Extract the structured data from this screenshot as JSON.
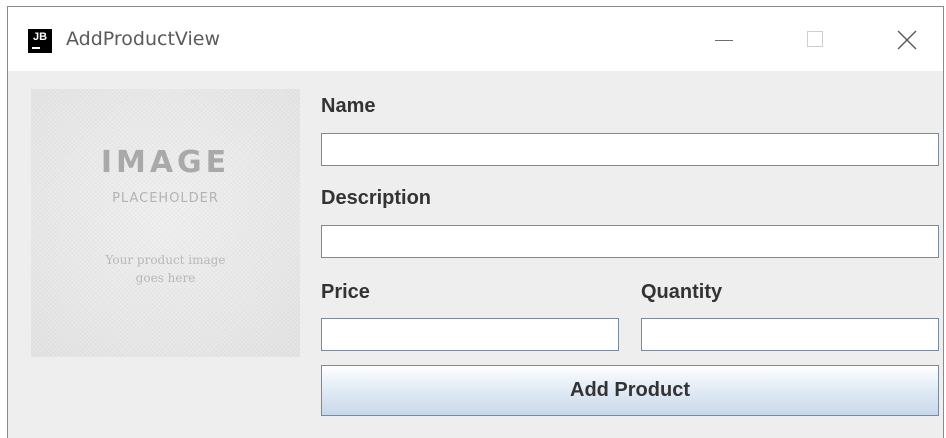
{
  "window": {
    "title": "AddProductView",
    "app_icon": "JB"
  },
  "titlebar_buttons": {
    "minimize": "minimize-icon",
    "maximize": "maximize-icon",
    "close": "close-icon"
  },
  "image_placeholder": {
    "title": "IMAGE",
    "subtitle": "PLACEHOLDER",
    "caption_line1": "Your product image",
    "caption_line2": "goes here"
  },
  "form": {
    "name_label": "Name",
    "name_value": "",
    "description_label": "Description",
    "description_value": "",
    "price_label": "Price",
    "price_value": "",
    "quantity_label": "Quantity",
    "quantity_value": ""
  },
  "actions": {
    "add_product_label": "Add Product"
  },
  "colors": {
    "window_bg": "#eeeeee",
    "titlebar_bg": "#ffffff",
    "field_border": "#7a8a99",
    "button_gradient_top": "#ffffff",
    "button_gradient_bottom": "#c9d8ea"
  }
}
